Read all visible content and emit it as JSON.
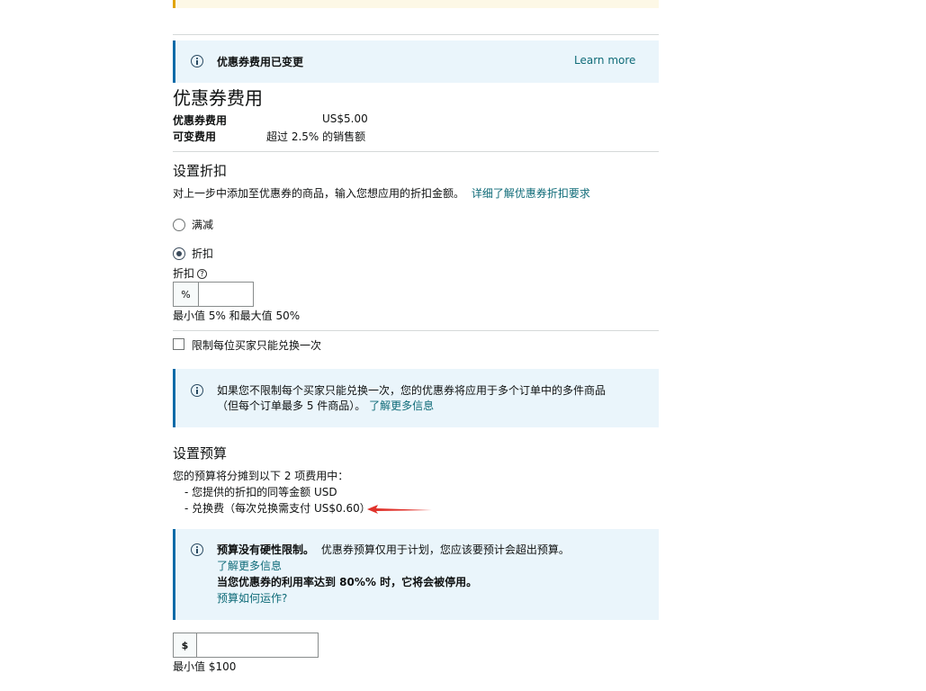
{
  "notice_fee_changed": {
    "title": "优惠券费用已变更",
    "learn_more": "Learn more"
  },
  "fees": {
    "heading": "优惠券费用",
    "rows": [
      {
        "label": "优惠券费用",
        "value": "US$5.00"
      },
      {
        "label": "可变费用",
        "value": "超过 2.5% 的销售额"
      }
    ]
  },
  "discount": {
    "heading": "设置折扣",
    "description": "对上一步中添加至优惠券的商品，输入您想应用的折扣金额。",
    "link": "详细了解优惠券折扣要求",
    "option_amount": "满减",
    "option_percent": "折扣",
    "field_label": "折扣",
    "help_glyph": "?",
    "prefix": "%",
    "value": "",
    "hint": "最小值 5% 和最大值 50%",
    "limit_checkbox": "限制每位买家只能兑换一次"
  },
  "notice_limit": {
    "line1": "如果您不限制每个买家只能兑换一次，您的优惠券将应用于多个订单中的多件商品",
    "line2": "（但每个订单最多 5 件商品）。",
    "link": "了解更多信息"
  },
  "budget": {
    "heading": "设置预算",
    "intro": "您的预算将分摊到以下 2 项费用中：",
    "items": [
      "- 您提供的折扣的同等金额 USD",
      "- 兑换费（每次兑换需支付 US$0.60）"
    ],
    "prefix": "$",
    "value": "",
    "hint": "最小值 $100"
  },
  "notice_budget": {
    "title": "预算没有硬性限制。",
    "text": "优惠券预算仅用于计划，您应该要预计会超出预算。",
    "link1": "了解更多信息",
    "warning": "当您优惠券的利用率达到 80%% 时，它将会被停用。",
    "link2": "预算如何运作?"
  },
  "colors": {
    "info_bg": "#eaf5fb",
    "info_border": "#0f6ba8",
    "link": "#0f6b78",
    "warning_border": "#e0a400",
    "annotation_arrow": "#e0322b"
  }
}
